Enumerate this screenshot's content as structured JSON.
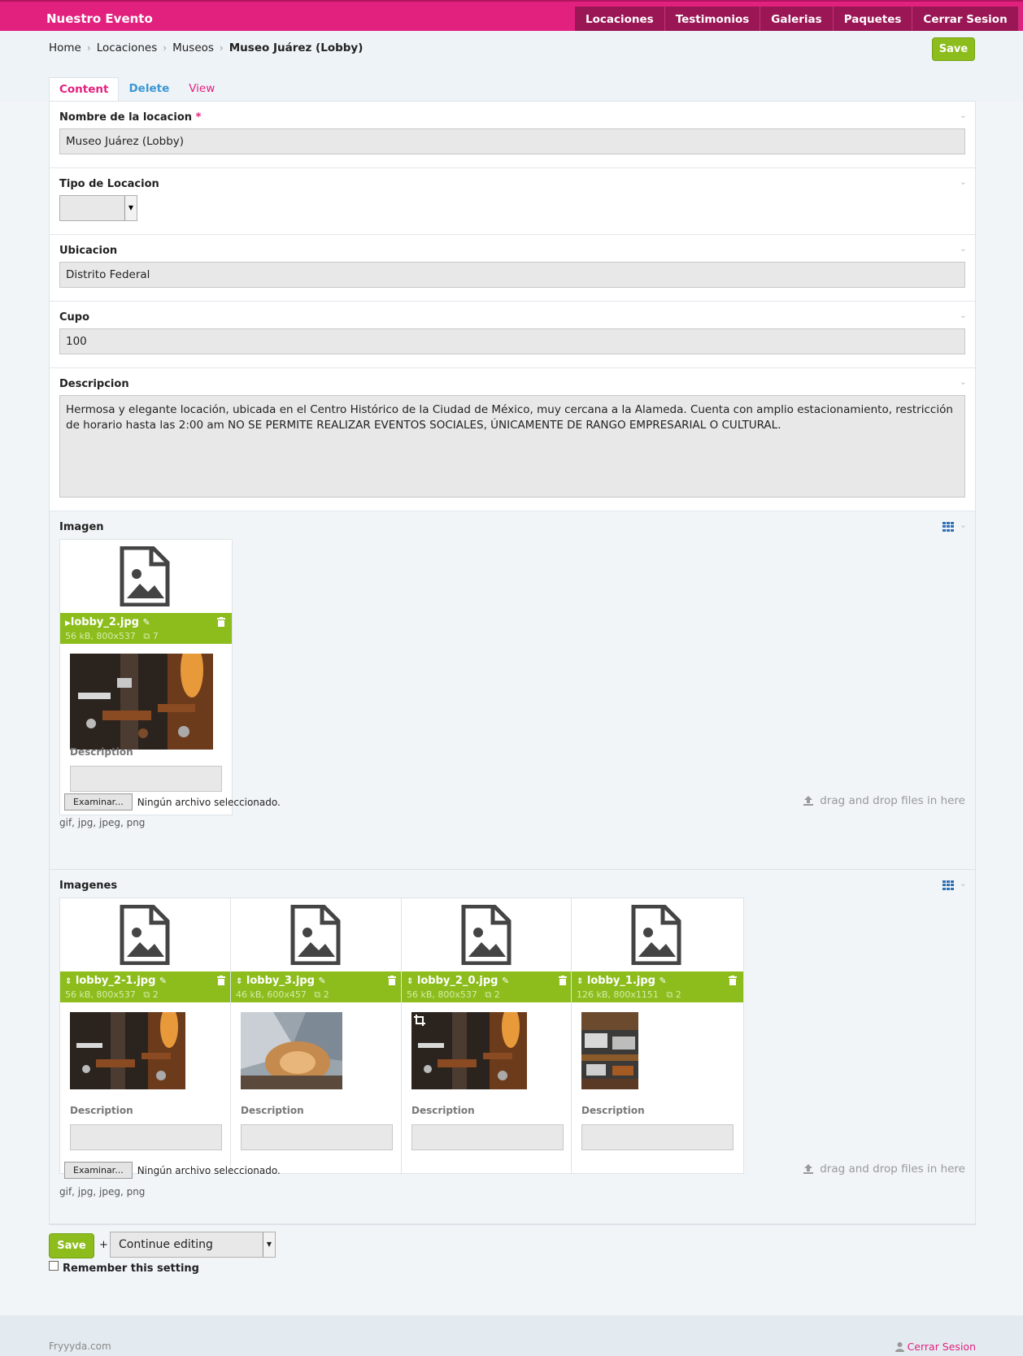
{
  "app": {
    "brand": "Nuestro Evento"
  },
  "nav": [
    "Locaciones",
    "Testimonios",
    "Galerias",
    "Paquetes",
    "Cerrar Sesion"
  ],
  "breadcrumb": [
    "Home",
    "Locaciones",
    "Museos",
    "Museo Juárez (Lobby)"
  ],
  "toolbar": {
    "save_label": "Save"
  },
  "tabs": [
    "Content",
    "Delete",
    "View"
  ],
  "form": {
    "nombre": {
      "label": "Nombre de la locacion",
      "required": "*",
      "value": "Museo Juárez (Lobby)"
    },
    "tipo": {
      "label": "Tipo de Locacion",
      "value": ""
    },
    "ubicacion": {
      "label": "Ubicacion",
      "value": "Distrito Federal"
    },
    "cupo": {
      "label": "Cupo",
      "value": "100"
    },
    "descripcion": {
      "label": "Descripcion",
      "value": "Hermosa y elegante locación, ubicada en el Centro Histórico de la Ciudad de México, muy cercana a la Alameda. Cuenta con amplio estacionamiento, restricción de horario hasta las 2:00 am NO SE PERMITE REALIZAR EVENTOS SOCIALES, ÚNICAMENTE DE RANGO EMPRESARIAL O CULTURAL."
    }
  },
  "imagen": {
    "label": "Imagen",
    "files": [
      {
        "name": "lobby_2.jpg",
        "meta": "56 kB, 800x537",
        "count": "7",
        "description_label": "Description"
      }
    ],
    "browse_label": "Examinar...",
    "no_file": "Ningún archivo seleccionado.",
    "types": "gif, jpg, jpeg, png",
    "dnd": "drag and drop files in here"
  },
  "imagenes": {
    "label": "Imagenes",
    "files": [
      {
        "name": "lobby_2-1.jpg",
        "meta": "56 kB, 800x537",
        "count": "2",
        "description_label": "Description"
      },
      {
        "name": "lobby_3.jpg",
        "meta": "46 kB, 600x457",
        "count": "2",
        "description_label": "Description"
      },
      {
        "name": "lobby_2_0.jpg",
        "meta": "56 kB, 800x537",
        "count": "2",
        "description_label": "Description"
      },
      {
        "name": "lobby_1.jpg",
        "meta": "126 kB, 800x1151",
        "count": "2",
        "description_label": "Description"
      }
    ],
    "browse_label": "Examinar...",
    "no_file": "Ningún archivo seleccionado.",
    "types": "gif, jpg, jpeg, png",
    "dnd": "drag and drop files in here"
  },
  "actions": {
    "save_label": "Save",
    "plus": "+",
    "continue_value": "Continue editing",
    "remember_label": "Remember this setting"
  },
  "footer": {
    "site": "Fryyyda.com",
    "logout": "Cerrar Sesion"
  },
  "colors": {
    "brand": "#e2207e",
    "nav_dark": "#9a1654",
    "accent_green": "#8cbd1c",
    "link_blue": "#3b97d3"
  },
  "icons": [
    "chevron-down-icon",
    "grid-view-icon",
    "file-image-icon",
    "trash-icon",
    "pencil-icon",
    "copy-icon",
    "upload-icon",
    "user-icon",
    "crop-icon",
    "sort-icon"
  ]
}
